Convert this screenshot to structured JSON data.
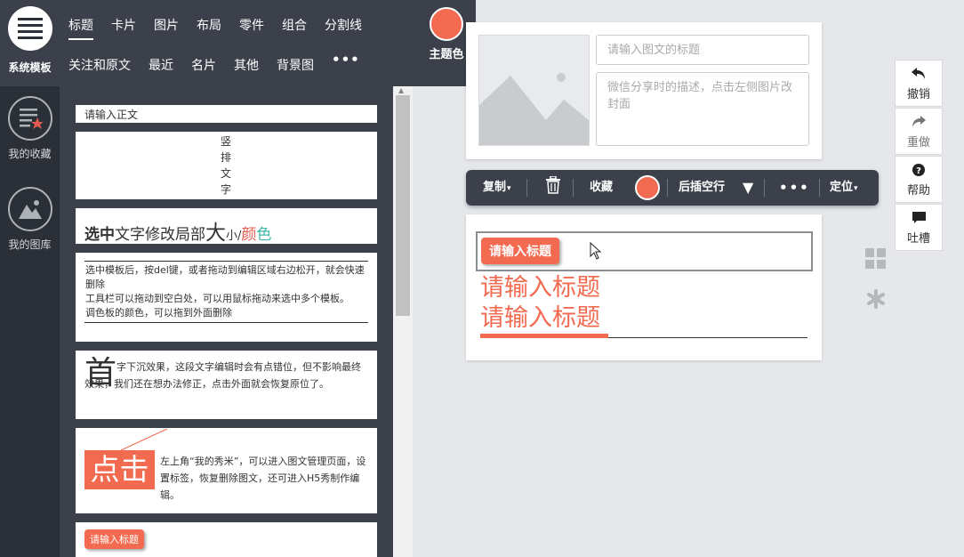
{
  "rail": {
    "items": [
      {
        "label": "系统模板",
        "icon": "menu-lines-icon"
      },
      {
        "label": "我的收藏",
        "icon": "favorites-icon"
      },
      {
        "label": "我的图库",
        "icon": "gallery-icon"
      }
    ]
  },
  "topmenu": {
    "row1": [
      "标题",
      "卡片",
      "图片",
      "布局",
      "零件",
      "组合",
      "分割线"
    ],
    "row2": [
      "关注和原文",
      "最近",
      "名片",
      "其他",
      "背景图"
    ],
    "more": "•••",
    "theme_label": "主题色",
    "theme_color": "#f26b51"
  },
  "panel": {
    "card_body": "请输入正文",
    "vertical_chars": [
      "竖",
      "排",
      "文",
      "字"
    ],
    "style_demo": {
      "bold": "选中",
      "normal": "文字修改局部",
      "big": "大",
      "small": "小/",
      "c1": "颜",
      "c2": "色"
    },
    "tips": [
      "选中模板后，按del键，或者拖动到编辑区域右边松开，就会快速删除",
      "工具栏可以拖动到空白处，可以用鼠标拖动来选中多个模板。",
      "调色板的颜色，可以拖到外面删除"
    ],
    "dropcap_char": "首",
    "dropcap_text": "字下沉效果，这段文字编辑时会有点错位，但不影响最终效果，我们还在想办法修正，点击外面就会恢复原位了。",
    "click_word": "点击",
    "click_text": "左上角“我的秀米”，可以进入图文管理页面，设置标签，恢复删除图文，还可进入H5秀制作编辑。",
    "badge_title": "请输入标题"
  },
  "editor": {
    "title_placeholder": "请输入图文的标题",
    "desc_placeholder": "微信分享时的描述，点击左侧图片改封面",
    "selected_badge": "请输入标题",
    "big_title_1": "请输入标题",
    "big_title_2": "请输入标题"
  },
  "toolbar": {
    "copy": "复制",
    "favorite": "收藏",
    "insert_after": "后插空行",
    "more": "•••",
    "position": "定位"
  },
  "right_buttons": [
    {
      "label": "撤销",
      "icon": "undo-icon"
    },
    {
      "label": "重做",
      "icon": "redo-icon"
    },
    {
      "label": "帮助",
      "icon": "help-icon"
    },
    {
      "label": "吐槽",
      "icon": "comment-icon"
    }
  ],
  "colors": {
    "accent": "#f26b51",
    "dark": "#3b404b",
    "rail": "#2b2f38"
  }
}
